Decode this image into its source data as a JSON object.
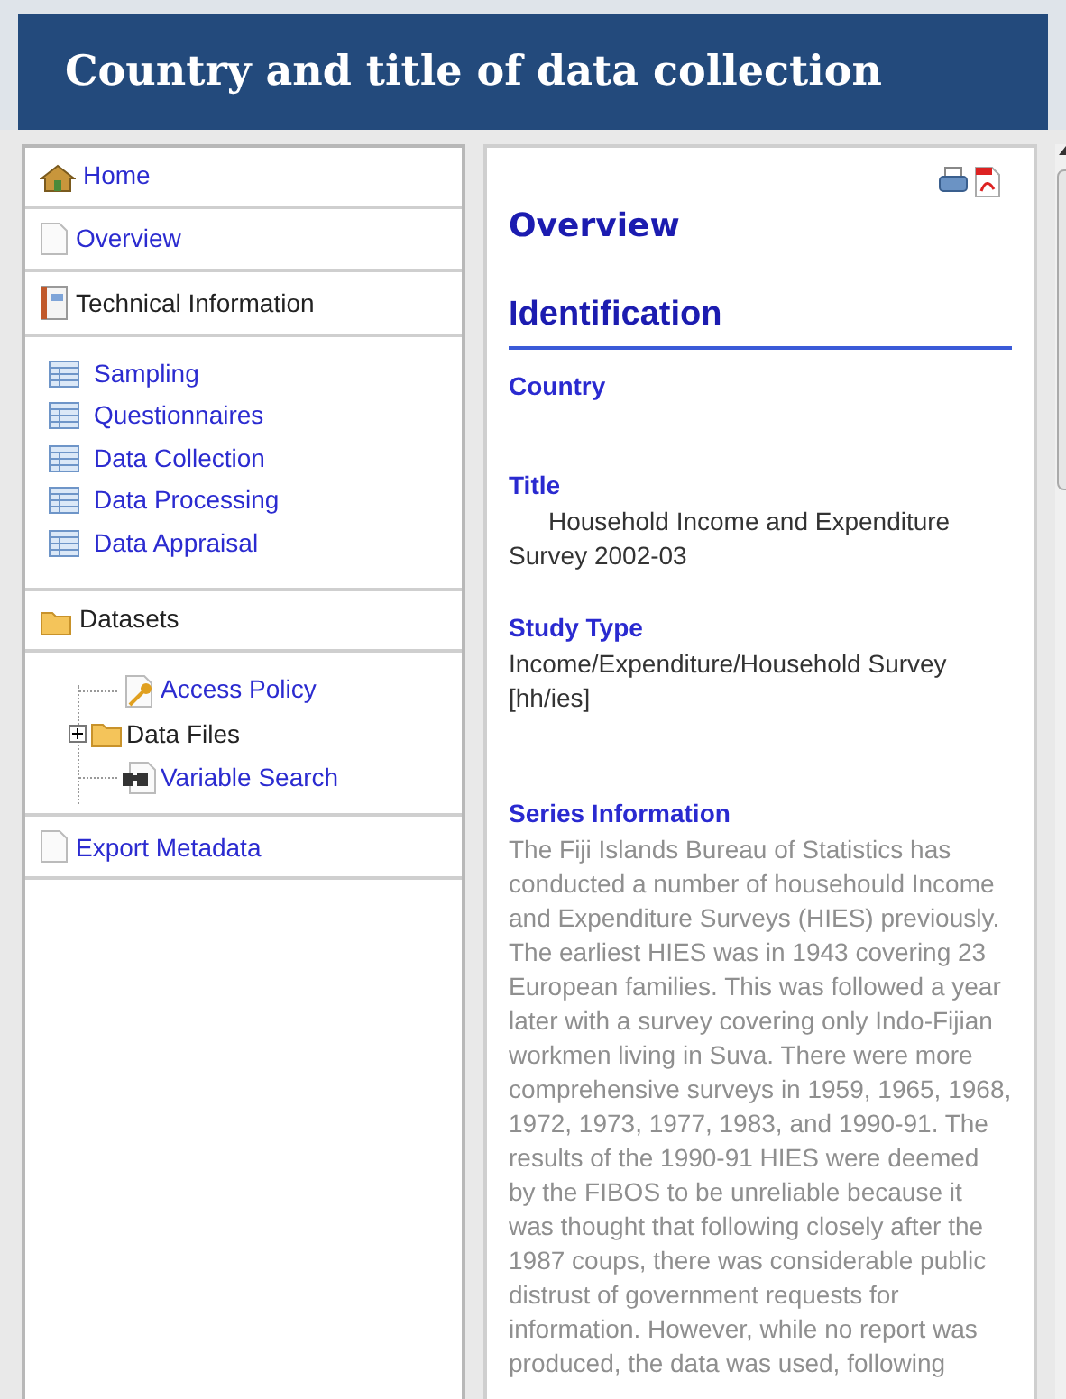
{
  "header": {
    "title": "Country and title of data collection"
  },
  "sidebar": {
    "sections": [
      {
        "kind": "home",
        "label": "Home",
        "link": true
      },
      {
        "kind": "page",
        "label": "Overview",
        "link": true
      },
      {
        "kind": "book",
        "label": "Technical Information",
        "link": false,
        "children": [
          {
            "kind": "table",
            "label": "Sampling"
          },
          {
            "kind": "table",
            "label": "Questionnaires"
          },
          {
            "kind": "table",
            "label": "Data Collection"
          },
          {
            "kind": "table",
            "label": "Data Processing"
          },
          {
            "kind": "table",
            "label": "Data Appraisal"
          }
        ]
      },
      {
        "kind": "folder",
        "label": "Datasets",
        "link": false,
        "tree": [
          {
            "kind": "key",
            "label": "Access Policy",
            "link": true
          },
          {
            "kind": "folder",
            "label": "Data Files",
            "link": false,
            "expanded": false
          },
          {
            "kind": "binoculars",
            "label": "Variable Search",
            "link": true
          }
        ]
      },
      {
        "kind": "page",
        "label": "Export Metadata",
        "link": true
      }
    ]
  },
  "content": {
    "page_title": "Overview",
    "section_title": "Identification",
    "fields": [
      {
        "label": "Country"
      },
      {
        "label": "Title",
        "value": "Household Income and Expenditure Survey 2002-03",
        "indent": true
      },
      {
        "label": "Study Type",
        "value": "Income/Expenditure/Household Survey [hh/ies]"
      },
      {
        "label": "Series Information",
        "value": "The Fiji Islands Bureau of Statistics has conducted a number of househould Income and Expenditure Surveys (HIES) previously. The earliest HIES was in 1943 covering 23 European families. This was followed a year later with a survey covering only Indo-Fijian workmen living in Suva. There were more comprehensive surveys in 1959, 1965, 1968, 1972, 1973, 1977, 1983, and 1990-91. The results of the 1990-91 HIES were deemed by the FIBOS to be unreliable because it was thought that following closely after the 1987 coups, there was considerable public distrust of government requests for information. However, while no report was produced, the data was used, following",
        "faded": true
      }
    ]
  }
}
